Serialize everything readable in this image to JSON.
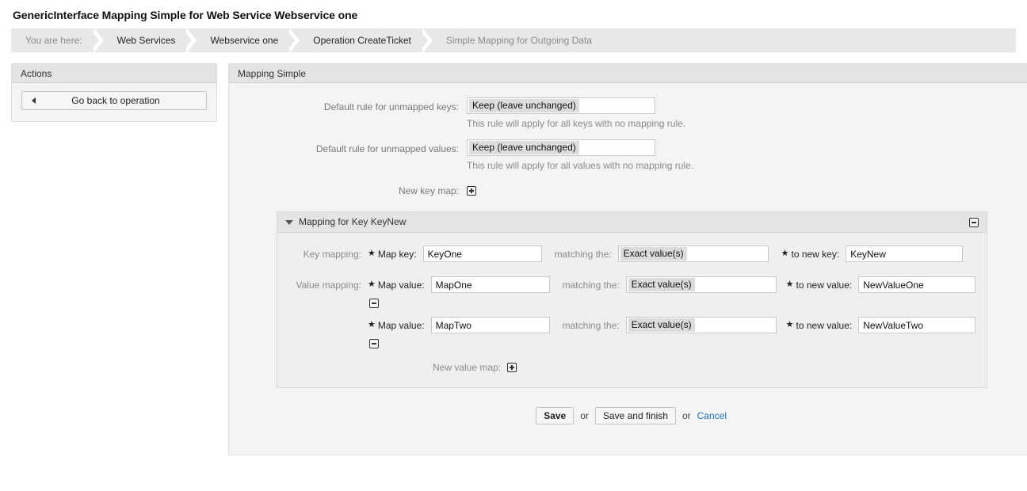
{
  "page": {
    "title": "GenericInterface Mapping Simple for Web Service Webservice one"
  },
  "breadcrumb": {
    "prefix": "You are here:",
    "items": [
      {
        "label": "Web Services"
      },
      {
        "label": "Webservice one"
      },
      {
        "label": "Operation CreateTicket"
      },
      {
        "label": "Simple Mapping for Outgoing Data"
      }
    ]
  },
  "sidebar": {
    "header": "Actions",
    "back_button": {
      "label": "Go back to operation",
      "icon": "triangle-left-icon"
    }
  },
  "main": {
    "header": "Mapping Simple",
    "default_key_rule": {
      "label": "Default rule for unmapped keys:",
      "value": "Keep (leave unchanged)",
      "hint": "This rule will apply for all keys with no mapping rule."
    },
    "default_value_rule": {
      "label": "Default rule for unmapped values:",
      "value": "Keep (leave unchanged)",
      "hint": "This rule will apply for all values with no mapping rule."
    },
    "new_key_map": {
      "label": "New key map:",
      "icon": "plus-box-icon"
    },
    "panel": {
      "title": "Mapping for Key KeyNew",
      "collapse_icon": "triangle-down-icon",
      "remove_icon": "minus-box-icon",
      "key_mapping": {
        "group_label": "Key mapping:",
        "map_key_label": "Map key:",
        "map_key_value": "KeyOne",
        "matching_label": "matching the:",
        "matching_value": "Exact value(s)",
        "to_new_label": "to new key:",
        "to_new_value": "KeyNew",
        "required_marker": "★"
      },
      "value_mapping": {
        "group_label": "Value mapping:",
        "rows": [
          {
            "map_value_label": "Map value:",
            "map_value": "MapOne",
            "matching_label": "matching the:",
            "matching_value": "Exact value(s)",
            "to_new_label": "to new value:",
            "to_new_value": "NewValueOne",
            "remove_icon": "minus-box-icon"
          },
          {
            "map_value_label": "Map value:",
            "map_value": "MapTwo",
            "matching_label": "matching the:",
            "matching_value": "Exact value(s)",
            "to_new_label": "to new value:",
            "to_new_value": "NewValueTwo",
            "remove_icon": "minus-box-icon"
          }
        ],
        "new_value_map_label": "New value map:",
        "new_value_map_icon": "plus-box-icon",
        "required_marker": "★"
      }
    },
    "footer": {
      "save_label": "Save",
      "or_1": "or",
      "save_finish_label": "Save and finish",
      "or_2": "or",
      "cancel_label": "Cancel"
    }
  },
  "colors": {
    "link": "#1f6fb4",
    "header_bg": "#e4e4e4",
    "panel_bg": "#f0efee",
    "widget_bg": "#f4f4f4"
  }
}
